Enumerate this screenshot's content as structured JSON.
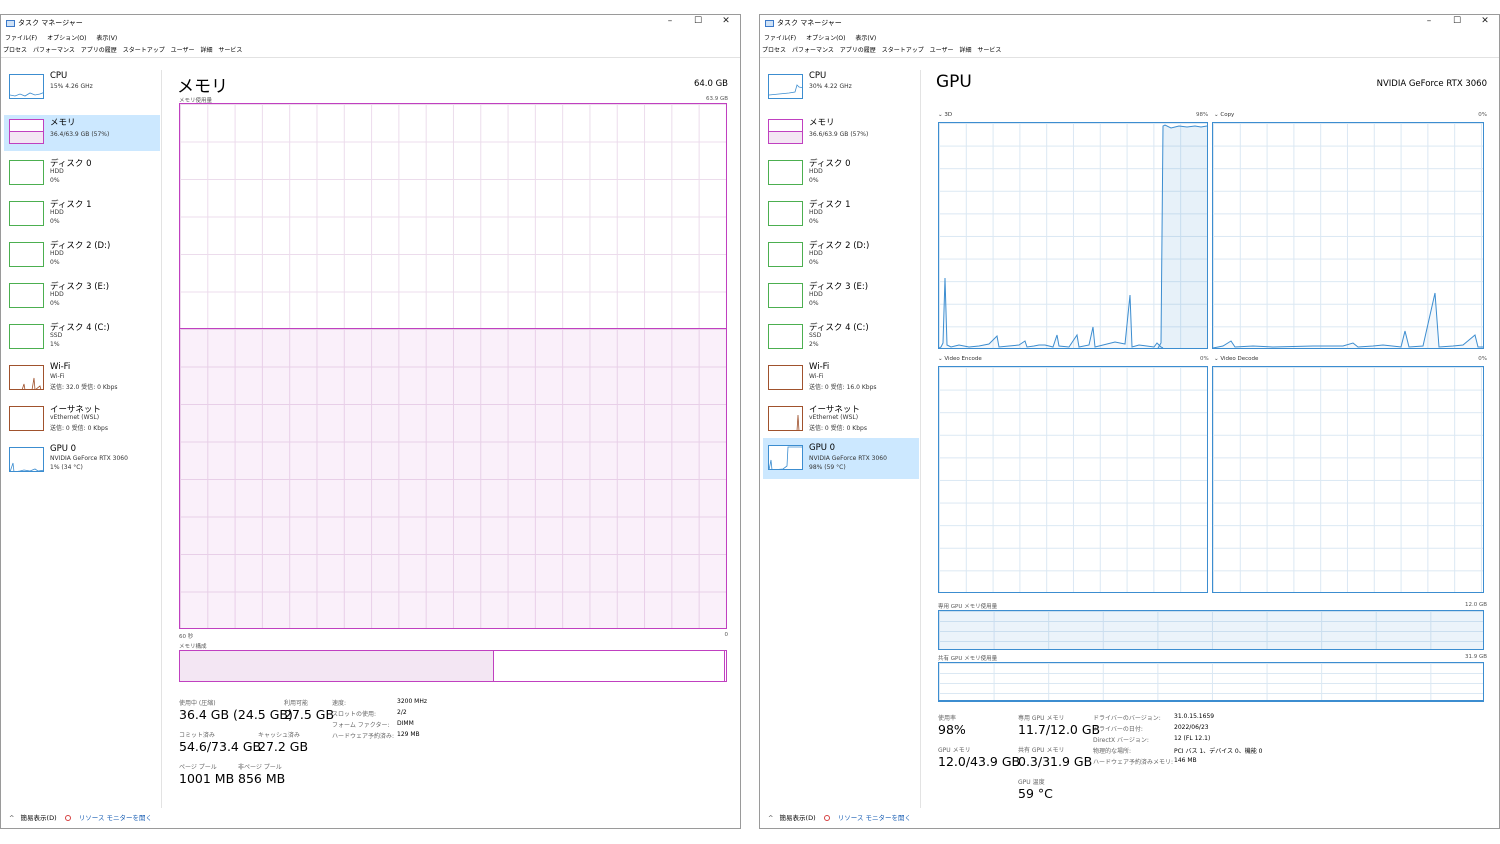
{
  "app": {
    "title": "タスク マネージャー",
    "menu": [
      "ファイル(F)",
      "オプション(O)",
      "表示(V)"
    ],
    "tabs": [
      "プロセス",
      "パフォーマンス",
      "アプリの履歴",
      "スタートアップ",
      "ユーザー",
      "詳細",
      "サービス"
    ],
    "controls": {
      "minimize": "–",
      "maximize": "☐",
      "close": "✕"
    },
    "footer": {
      "fewer_details": "簡易表示(D)",
      "resource_monitor": "リソース モニターを開く"
    }
  },
  "colors": {
    "memory": "#c040c0",
    "disk": "#4caf50",
    "network": "#a0522d",
    "gpu": "#3c8dd0",
    "cpu": "#3c8dd0",
    "selected": "#cce8ff"
  },
  "left": {
    "sidebar": [
      {
        "name": "CPU",
        "l1": "15% 4.26 GHz",
        "l2": "",
        "l3": ""
      },
      {
        "name": "メモリ",
        "l1": "36.4/63.9 GB (57%)",
        "l2": "",
        "l3": ""
      },
      {
        "name": "ディスク 0",
        "l1": "HDD",
        "l2": "0%",
        "l3": ""
      },
      {
        "name": "ディスク 1",
        "l1": "HDD",
        "l2": "0%",
        "l3": ""
      },
      {
        "name": "ディスク 2 (D:)",
        "l1": "HDD",
        "l2": "0%",
        "l3": ""
      },
      {
        "name": "ディスク 3 (E:)",
        "l1": "HDD",
        "l2": "0%",
        "l3": ""
      },
      {
        "name": "ディスク 4 (C:)",
        "l1": "SSD",
        "l2": "1%",
        "l3": ""
      },
      {
        "name": "Wi-Fi",
        "l1": "Wi-Fi",
        "l2": "送信: 32.0 受信: 0 Kbps",
        "l3": ""
      },
      {
        "name": "イーサネット",
        "l1": "vEthernet (WSL)",
        "l2": "送信: 0 受信: 0 Kbps",
        "l3": ""
      },
      {
        "name": "GPU 0",
        "l1": "NVIDIA GeForce RTX 3060",
        "l2": "1% (34 °C)",
        "l3": ""
      }
    ],
    "title": "メモリ",
    "total": "64.0 GB",
    "usage_label": "メモリ使用量",
    "usage_max": "63.9 GB",
    "axis_left": "60 秒",
    "axis_right": "0",
    "composition_label": "メモリ構成",
    "stats": {
      "in_use_label": "使用中 (圧縮)",
      "in_use": "36.4 GB (24.5 GB)",
      "available_label": "利用可能",
      "available": "27.5 GB",
      "committed_label": "コミット済み",
      "committed": "54.6/73.4 GB",
      "cached_label": "キャッシュ済み",
      "cached": "27.2 GB",
      "paged_label": "ページ プール",
      "paged": "1001 MB",
      "nonpaged_label": "非ページ プール",
      "nonpaged": "856 MB"
    },
    "details": [
      {
        "k": "速度:",
        "v": "3200 MHz"
      },
      {
        "k": "スロットの使用:",
        "v": "2/2"
      },
      {
        "k": "フォーム ファクター:",
        "v": "DIMM"
      },
      {
        "k": "ハードウェア予約済み:",
        "v": "129 MB"
      }
    ]
  },
  "right": {
    "sidebar": [
      {
        "name": "CPU",
        "l1": "30% 4.22 GHz",
        "l2": "",
        "l3": ""
      },
      {
        "name": "メモリ",
        "l1": "36.6/63.9 GB (57%)",
        "l2": "",
        "l3": ""
      },
      {
        "name": "ディスク 0",
        "l1": "HDD",
        "l2": "0%",
        "l3": ""
      },
      {
        "name": "ディスク 1",
        "l1": "HDD",
        "l2": "0%",
        "l3": ""
      },
      {
        "name": "ディスク 2 (D:)",
        "l1": "HDD",
        "l2": "0%",
        "l3": ""
      },
      {
        "name": "ディスク 3 (E:)",
        "l1": "HDD",
        "l2": "0%",
        "l3": ""
      },
      {
        "name": "ディスク 4 (C:)",
        "l1": "SSD",
        "l2": "2%",
        "l3": ""
      },
      {
        "name": "Wi-Fi",
        "l1": "Wi-Fi",
        "l2": "送信: 0 受信: 16.0 Kbps",
        "l3": ""
      },
      {
        "name": "イーサネット",
        "l1": "vEthernet (WSL)",
        "l2": "送信: 0 受信: 0 Kbps",
        "l3": ""
      },
      {
        "name": "GPU 0",
        "l1": "NVIDIA GeForce RTX 3060",
        "l2": "98% (59 °C)",
        "l3": ""
      }
    ],
    "title": "GPU",
    "model": "NVIDIA GeForce RTX 3060",
    "engines": [
      {
        "name": "3D",
        "pct": "98%"
      },
      {
        "name": "Copy",
        "pct": "0%"
      },
      {
        "name": "Video Encode",
        "pct": "0%"
      },
      {
        "name": "Video Decode",
        "pct": "0%"
      }
    ],
    "dedicated_label": "専用 GPU メモリ使用量",
    "dedicated_max": "12.0 GB",
    "shared_label": "共有 GPU メモリ使用量",
    "shared_max": "31.9 GB",
    "stats": {
      "util_label": "使用率",
      "util": "98%",
      "ded_label": "専用 GPU メモリ",
      "ded": "11.7/12.0 GB",
      "gpumem_label": "GPU メモリ",
      "gpumem": "12.0/43.9 GB",
      "shared_label": "共有 GPU メモリ",
      "shared": "0.3/31.9 GB",
      "temp_label": "GPU 温度",
      "temp": "59 °C"
    },
    "details": [
      {
        "k": "ドライバーのバージョン:",
        "v": "31.0.15.1659"
      },
      {
        "k": "ドライバーの日付:",
        "v": "2022/06/23"
      },
      {
        "k": "DirectX バージョン:",
        "v": "12 (FL 12.1)"
      },
      {
        "k": "物理的な場所:",
        "v": "PCI バス 1、デバイス 0、機能 0"
      },
      {
        "k": "ハードウェア予約済みメモリ:",
        "v": "146 MB"
      }
    ]
  }
}
